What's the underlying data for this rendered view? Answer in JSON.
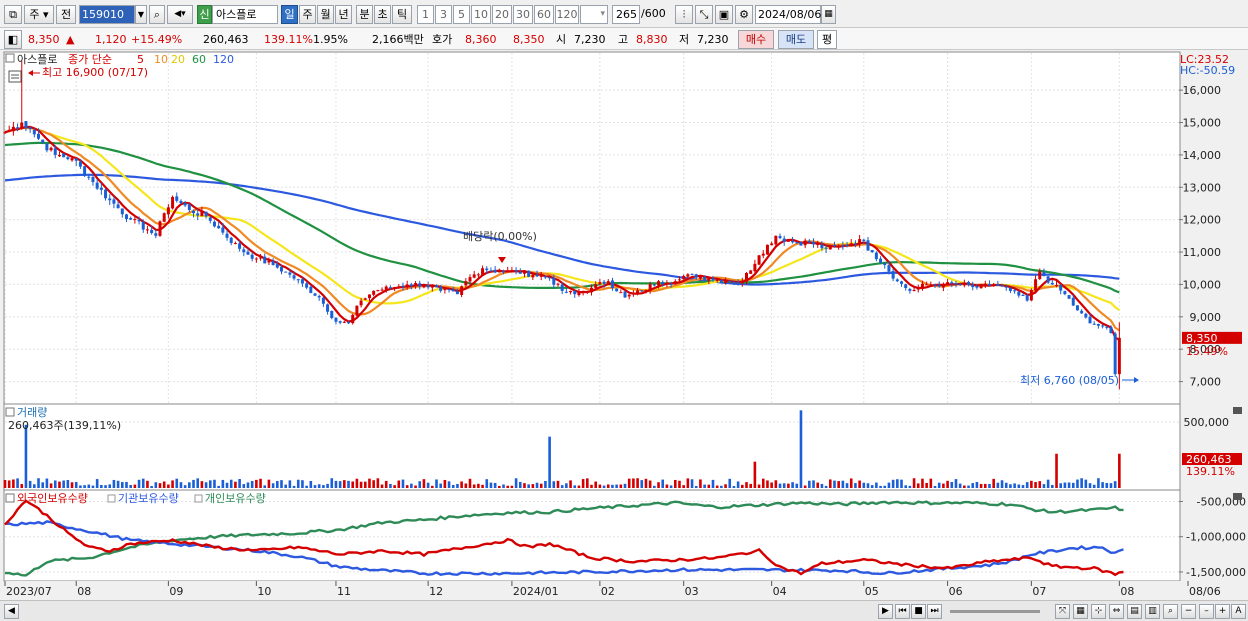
{
  "toolbar": {
    "period_main": "주",
    "prev_label": "전",
    "stock_code": "159010",
    "market_badge": "신",
    "stock_name": "아스플로",
    "periods": [
      "일",
      "주",
      "월",
      "년",
      "분",
      "초",
      "틱"
    ],
    "active_period": "일",
    "intervals": [
      "1",
      "3",
      "5",
      "10",
      "20",
      "30",
      "60",
      "120"
    ],
    "count_value": "265",
    "count_total": "/600",
    "date_value": "2024/08/06"
  },
  "quote": {
    "price": "8,350",
    "change_arrow": "▲",
    "change": "1,120",
    "change_pct": "+15.49%",
    "volume": "260,463",
    "volume_ratio": "139.11%",
    "turnover": "1.95%",
    "amount": "2,166백만",
    "ask_label": "호가",
    "ask_value": "8,360",
    "bid_value": "8,350",
    "open_label": "시",
    "open_value": "7,230",
    "high_label": "고",
    "high_value": "8,830",
    "low_label": "저",
    "low_value": "7,230",
    "buy_label": "매수",
    "sell_label": "매도",
    "extra_label": "평"
  },
  "colors": {
    "up": "#d40000",
    "down": "#1a5fd6",
    "ma5": "#d40000",
    "ma10": "#f08a24",
    "ma20": "#f5e61c",
    "ma60": "#1f9140",
    "ma120": "#2c59e0",
    "foreign": "#d40000",
    "institution": "#2c59e0",
    "individual": "#2e8b57"
  },
  "chart_data": [
    {
      "type": "candlestick",
      "legend": {
        "name": "아스플로",
        "ma_label": "종가 단순",
        "periods": [
          "5",
          "10",
          "20",
          "60",
          "120"
        ]
      },
      "lc_label": "LC:23.52",
      "hc_label": "HC:-50.59",
      "ylim": [
        6400,
        16900
      ],
      "yticks": [
        7000,
        8000,
        9000,
        10000,
        11000,
        12000,
        13000,
        14000,
        15000,
        16000
      ],
      "ytick_labels": [
        "7,000",
        "8,000",
        "9,000",
        "10,000",
        "11,000",
        "12,000",
        "13,000",
        "14,000",
        "15,000",
        "16,000"
      ],
      "x_labels": [
        "2023/07",
        "08",
        "09",
        "10",
        "11",
        "12",
        "2024/01",
        "02",
        "03",
        "04",
        "05",
        "06",
        "07",
        "08",
        "08/06"
      ],
      "x_label_days": [
        0,
        17,
        39,
        60,
        79,
        101,
        121,
        142,
        162,
        183,
        205,
        225,
        245,
        266,
        280
      ],
      "close_anchors": [
        [
          0,
          14700
        ],
        [
          4,
          15000
        ],
        [
          6,
          14800
        ],
        [
          8,
          14500
        ],
        [
          12,
          14000
        ],
        [
          16,
          13900
        ],
        [
          20,
          13300
        ],
        [
          25,
          12600
        ],
        [
          30,
          12000
        ],
        [
          34,
          11700
        ],
        [
          36,
          11500
        ],
        [
          38,
          12200
        ],
        [
          40,
          12700
        ],
        [
          44,
          12300
        ],
        [
          48,
          12100
        ],
        [
          52,
          11600
        ],
        [
          56,
          11100
        ],
        [
          60,
          10800
        ],
        [
          64,
          10600
        ],
        [
          68,
          10300
        ],
        [
          72,
          9900
        ],
        [
          75,
          9600
        ],
        [
          79,
          8850
        ],
        [
          82,
          8800
        ],
        [
          85,
          9500
        ],
        [
          88,
          9800
        ],
        [
          92,
          9900
        ],
        [
          96,
          10000
        ],
        [
          100,
          10000
        ],
        [
          104,
          9800
        ],
        [
          108,
          9700
        ],
        [
          110,
          10100
        ],
        [
          114,
          10500
        ],
        [
          118,
          10400
        ],
        [
          122,
          10400
        ],
        [
          126,
          10300
        ],
        [
          130,
          10200
        ],
        [
          133,
          9800
        ],
        [
          136,
          9700
        ],
        [
          140,
          9900
        ],
        [
          144,
          10100
        ],
        [
          148,
          9600
        ],
        [
          152,
          9800
        ],
        [
          156,
          10100
        ],
        [
          160,
          10100
        ],
        [
          164,
          10300
        ],
        [
          168,
          10200
        ],
        [
          172,
          10100
        ],
        [
          176,
          10100
        ],
        [
          180,
          10900
        ],
        [
          184,
          11500
        ],
        [
          188,
          11300
        ],
        [
          192,
          11300
        ],
        [
          196,
          11100
        ],
        [
          200,
          11200
        ],
        [
          204,
          11400
        ],
        [
          207,
          11000
        ],
        [
          210,
          10600
        ],
        [
          213,
          10100
        ],
        [
          216,
          9800
        ],
        [
          220,
          10000
        ],
        [
          224,
          10000
        ],
        [
          228,
          10000
        ],
        [
          232,
          9900
        ],
        [
          236,
          10000
        ],
        [
          240,
          9800
        ],
        [
          244,
          9500
        ],
        [
          247,
          10400
        ],
        [
          250,
          10000
        ],
        [
          253,
          9700
        ],
        [
          256,
          9200
        ],
        [
          259,
          8800
        ],
        [
          262,
          8700
        ],
        [
          264,
          8500
        ],
        [
          265,
          7230
        ],
        [
          266,
          8350
        ]
      ],
      "high_label": "최고 16,900 (07/17)",
      "low_label": "최저 6,760 (08/05)",
      "dividend_label": "배당락(0.00%)",
      "last_price_label": "8,350",
      "last_change_label": "15.49%"
    },
    {
      "type": "bar",
      "title": "거래량",
      "legend_value": "260,463주(139,11%)",
      "ylim": [
        0,
        600000
      ],
      "yticks": [
        500000
      ],
      "ytick_labels": [
        "500,000"
      ],
      "last_value_label": "260,463",
      "last_ratio_label": "139.11%",
      "spikes": [
        [
          5,
          480000
        ],
        [
          130,
          390000
        ],
        [
          179,
          200000
        ],
        [
          190,
          590000
        ],
        [
          251,
          260000
        ],
        [
          266,
          260463
        ]
      ],
      "base_volume": 50000
    },
    {
      "type": "line",
      "series": [
        {
          "name": "외국인보유수량",
          "points": [
            [
              0,
              -820000
            ],
            [
              5,
              -480000
            ],
            [
              10,
              -700000
            ],
            [
              15,
              -950000
            ],
            [
              20,
              -1150000
            ],
            [
              25,
              -1200000
            ],
            [
              30,
              -1100000
            ],
            [
              40,
              -1050000
            ],
            [
              50,
              -1150000
            ],
            [
              60,
              -1200000
            ],
            [
              70,
              -1150000
            ],
            [
              80,
              -1250000
            ],
            [
              90,
              -1200000
            ],
            [
              100,
              -1250000
            ],
            [
              110,
              -1150000
            ],
            [
              120,
              -1050000
            ],
            [
              125,
              -1150000
            ],
            [
              130,
              -1100000
            ],
            [
              140,
              -1300000
            ],
            [
              150,
              -1350000
            ],
            [
              160,
              -1330000
            ],
            [
              170,
              -1300000
            ],
            [
              180,
              -1200000
            ],
            [
              185,
              -1430000
            ],
            [
              190,
              -1520000
            ],
            [
              195,
              -1380000
            ],
            [
              205,
              -1330000
            ],
            [
              215,
              -1400000
            ],
            [
              225,
              -1450000
            ],
            [
              235,
              -1350000
            ],
            [
              245,
              -1300000
            ],
            [
              250,
              -1420000
            ],
            [
              260,
              -1450000
            ],
            [
              265,
              -1530000
            ],
            [
              267,
              -1500000
            ]
          ]
        },
        {
          "name": "기관보유수량",
          "points": [
            [
              0,
              -830000
            ],
            [
              10,
              -800000
            ],
            [
              20,
              -920000
            ],
            [
              30,
              -1050000
            ],
            [
              40,
              -1100000
            ],
            [
              50,
              -1150000
            ],
            [
              60,
              -1200000
            ],
            [
              70,
              -1280000
            ],
            [
              80,
              -1430000
            ],
            [
              90,
              -1480000
            ],
            [
              100,
              -1520000
            ],
            [
              120,
              -1520000
            ],
            [
              140,
              -1500000
            ],
            [
              160,
              -1470000
            ],
            [
              180,
              -1470000
            ],
            [
              200,
              -1480000
            ],
            [
              210,
              -1520000
            ],
            [
              225,
              -1450000
            ],
            [
              235,
              -1400000
            ],
            [
              240,
              -1350000
            ],
            [
              245,
              -1250000
            ],
            [
              255,
              -1160000
            ],
            [
              262,
              -1150000
            ],
            [
              265,
              -1240000
            ],
            [
              267,
              -1180000
            ]
          ]
        },
        {
          "name": "개인보유수량",
          "points": [
            [
              0,
              -1500000
            ],
            [
              5,
              -1550000
            ],
            [
              10,
              -1350000
            ],
            [
              20,
              -1300000
            ],
            [
              30,
              -1150000
            ],
            [
              40,
              -1050000
            ],
            [
              50,
              -1000000
            ],
            [
              60,
              -970000
            ],
            [
              70,
              -950000
            ],
            [
              80,
              -900000
            ],
            [
              90,
              -800000
            ],
            [
              100,
              -760000
            ],
            [
              110,
              -700000
            ],
            [
              120,
              -660000
            ],
            [
              130,
              -650000
            ],
            [
              140,
              -600000
            ],
            [
              150,
              -560000
            ],
            [
              160,
              -520000
            ],
            [
              170,
              -580000
            ],
            [
              180,
              -550000
            ],
            [
              190,
              -520000
            ],
            [
              200,
              -540000
            ],
            [
              210,
              -510000
            ],
            [
              220,
              -520000
            ],
            [
              230,
              -520000
            ],
            [
              240,
              -540000
            ],
            [
              245,
              -610000
            ],
            [
              250,
              -650000
            ],
            [
              260,
              -620000
            ],
            [
              265,
              -590000
            ],
            [
              267,
              -620000
            ]
          ]
        }
      ],
      "ylim": [
        -1600000,
        -380000
      ],
      "yticks": [
        -500000,
        -1000000,
        -1500000
      ],
      "ytick_labels": [
        "-500,000",
        "-1,000,000",
        "-1,500,000"
      ]
    }
  ]
}
